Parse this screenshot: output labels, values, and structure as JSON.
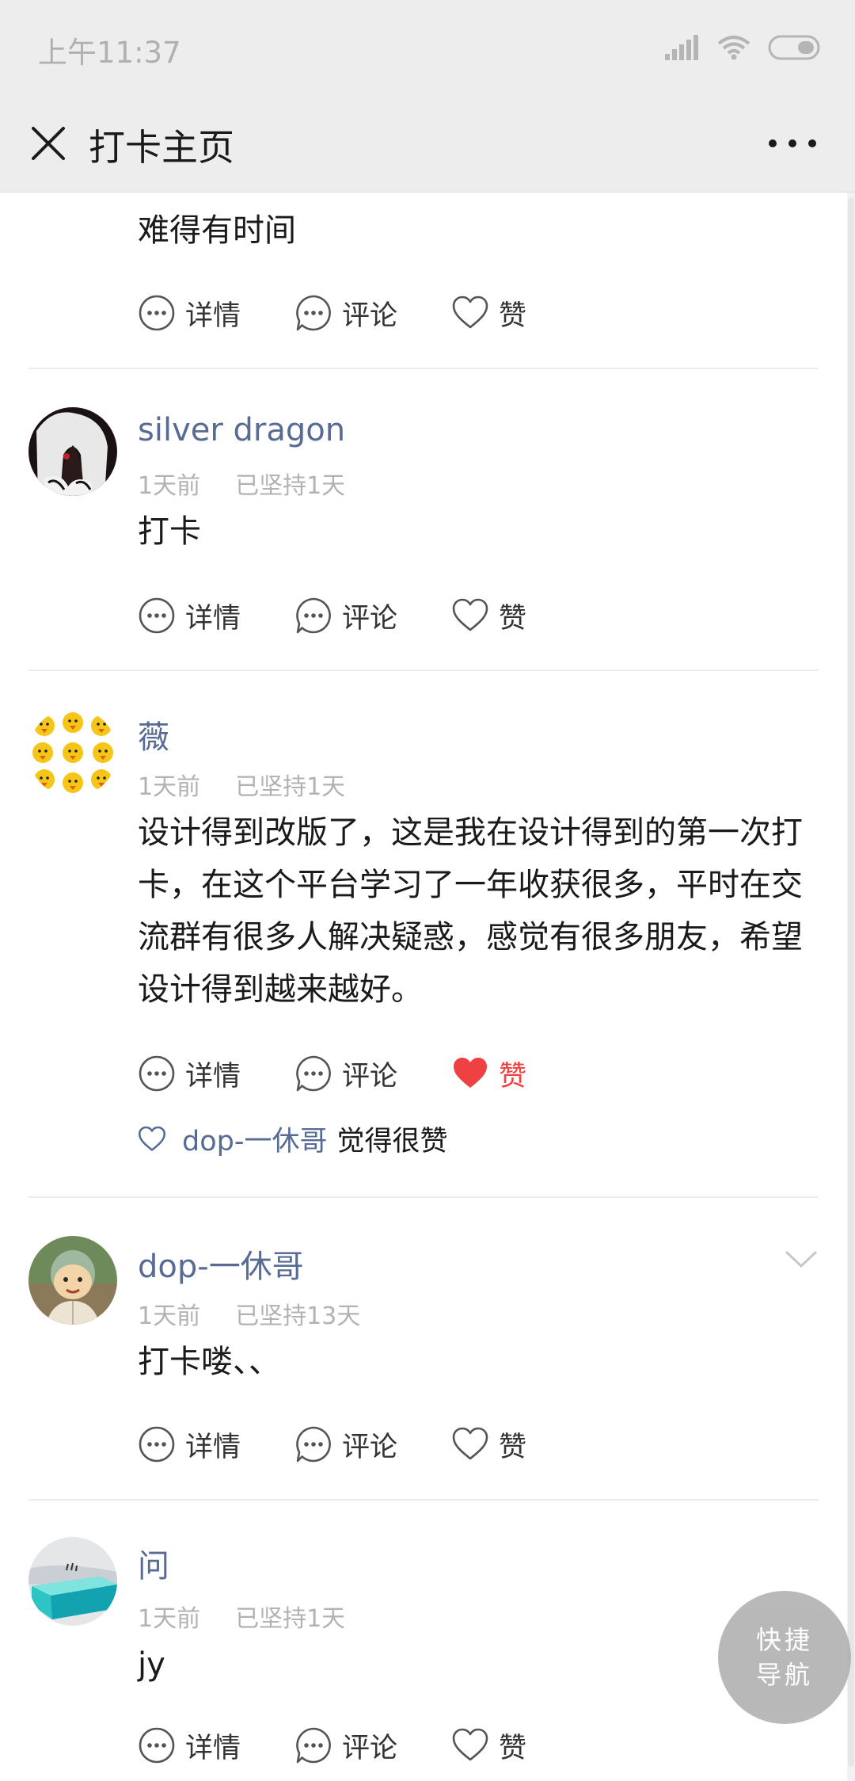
{
  "status_bar": {
    "time": "上午11:37"
  },
  "navbar": {
    "title": "打卡主页"
  },
  "actions": {
    "detail": "详情",
    "comment": "评论",
    "like": "赞"
  },
  "posts": [
    {
      "text": "难得有时间"
    },
    {
      "username": "silver dragon",
      "time_ago": "1天前",
      "streak": "已坚持1天",
      "text": "打卡"
    },
    {
      "username": "薇",
      "time_ago": "1天前",
      "streak": "已坚持1天",
      "text": "设计得到改版了，这是我在设计得到的第一次打卡，在这个平台学习了一年收获很多，平时在交流群有很多人解决疑惑，感觉有很多朋友，希望设计得到越来越好。",
      "liked": true,
      "liked_by": "dop-一休哥",
      "liked_suffix": "觉得很赞"
    },
    {
      "username": "dop-一休哥",
      "time_ago": "1天前",
      "streak": "已坚持13天",
      "text": "打卡喽、、"
    },
    {
      "username": "问",
      "time_ago": "1天前",
      "streak": "已坚持1天",
      "text": "jy"
    }
  ],
  "quick_nav": {
    "line1": "快捷",
    "line2": "导航"
  },
  "colors": {
    "link": "#576b95",
    "liked": "#f04142",
    "bar": "#ededed"
  }
}
